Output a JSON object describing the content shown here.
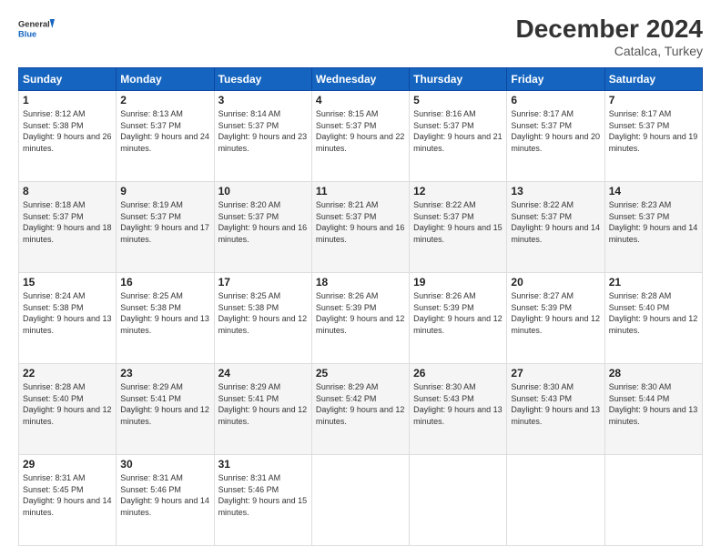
{
  "header": {
    "logo_general": "General",
    "logo_blue": "Blue",
    "month_year": "December 2024",
    "location": "Catalca, Turkey"
  },
  "days_of_week": [
    "Sunday",
    "Monday",
    "Tuesday",
    "Wednesday",
    "Thursday",
    "Friday",
    "Saturday"
  ],
  "weeks": [
    [
      {
        "day": 1,
        "sunrise": "8:12 AM",
        "sunset": "5:38 PM",
        "daylight": "9 hours and 26 minutes."
      },
      {
        "day": 2,
        "sunrise": "8:13 AM",
        "sunset": "5:37 PM",
        "daylight": "9 hours and 24 minutes."
      },
      {
        "day": 3,
        "sunrise": "8:14 AM",
        "sunset": "5:37 PM",
        "daylight": "9 hours and 23 minutes."
      },
      {
        "day": 4,
        "sunrise": "8:15 AM",
        "sunset": "5:37 PM",
        "daylight": "9 hours and 22 minutes."
      },
      {
        "day": 5,
        "sunrise": "8:16 AM",
        "sunset": "5:37 PM",
        "daylight": "9 hours and 21 minutes."
      },
      {
        "day": 6,
        "sunrise": "8:17 AM",
        "sunset": "5:37 PM",
        "daylight": "9 hours and 20 minutes."
      },
      {
        "day": 7,
        "sunrise": "8:17 AM",
        "sunset": "5:37 PM",
        "daylight": "9 hours and 19 minutes."
      }
    ],
    [
      {
        "day": 8,
        "sunrise": "8:18 AM",
        "sunset": "5:37 PM",
        "daylight": "9 hours and 18 minutes."
      },
      {
        "day": 9,
        "sunrise": "8:19 AM",
        "sunset": "5:37 PM",
        "daylight": "9 hours and 17 minutes."
      },
      {
        "day": 10,
        "sunrise": "8:20 AM",
        "sunset": "5:37 PM",
        "daylight": "9 hours and 16 minutes."
      },
      {
        "day": 11,
        "sunrise": "8:21 AM",
        "sunset": "5:37 PM",
        "daylight": "9 hours and 16 minutes."
      },
      {
        "day": 12,
        "sunrise": "8:22 AM",
        "sunset": "5:37 PM",
        "daylight": "9 hours and 15 minutes."
      },
      {
        "day": 13,
        "sunrise": "8:22 AM",
        "sunset": "5:37 PM",
        "daylight": "9 hours and 14 minutes."
      },
      {
        "day": 14,
        "sunrise": "8:23 AM",
        "sunset": "5:37 PM",
        "daylight": "9 hours and 14 minutes."
      }
    ],
    [
      {
        "day": 15,
        "sunrise": "8:24 AM",
        "sunset": "5:38 PM",
        "daylight": "9 hours and 13 minutes."
      },
      {
        "day": 16,
        "sunrise": "8:25 AM",
        "sunset": "5:38 PM",
        "daylight": "9 hours and 13 minutes."
      },
      {
        "day": 17,
        "sunrise": "8:25 AM",
        "sunset": "5:38 PM",
        "daylight": "9 hours and 12 minutes."
      },
      {
        "day": 18,
        "sunrise": "8:26 AM",
        "sunset": "5:39 PM",
        "daylight": "9 hours and 12 minutes."
      },
      {
        "day": 19,
        "sunrise": "8:26 AM",
        "sunset": "5:39 PM",
        "daylight": "9 hours and 12 minutes."
      },
      {
        "day": 20,
        "sunrise": "8:27 AM",
        "sunset": "5:39 PM",
        "daylight": "9 hours and 12 minutes."
      },
      {
        "day": 21,
        "sunrise": "8:28 AM",
        "sunset": "5:40 PM",
        "daylight": "9 hours and 12 minutes."
      }
    ],
    [
      {
        "day": 22,
        "sunrise": "8:28 AM",
        "sunset": "5:40 PM",
        "daylight": "9 hours and 12 minutes."
      },
      {
        "day": 23,
        "sunrise": "8:29 AM",
        "sunset": "5:41 PM",
        "daylight": "9 hours and 12 minutes."
      },
      {
        "day": 24,
        "sunrise": "8:29 AM",
        "sunset": "5:41 PM",
        "daylight": "9 hours and 12 minutes."
      },
      {
        "day": 25,
        "sunrise": "8:29 AM",
        "sunset": "5:42 PM",
        "daylight": "9 hours and 12 minutes."
      },
      {
        "day": 26,
        "sunrise": "8:30 AM",
        "sunset": "5:43 PM",
        "daylight": "9 hours and 13 minutes."
      },
      {
        "day": 27,
        "sunrise": "8:30 AM",
        "sunset": "5:43 PM",
        "daylight": "9 hours and 13 minutes."
      },
      {
        "day": 28,
        "sunrise": "8:30 AM",
        "sunset": "5:44 PM",
        "daylight": "9 hours and 13 minutes."
      }
    ],
    [
      {
        "day": 29,
        "sunrise": "8:31 AM",
        "sunset": "5:45 PM",
        "daylight": "9 hours and 14 minutes."
      },
      {
        "day": 30,
        "sunrise": "8:31 AM",
        "sunset": "5:46 PM",
        "daylight": "9 hours and 14 minutes."
      },
      {
        "day": 31,
        "sunrise": "8:31 AM",
        "sunset": "5:46 PM",
        "daylight": "9 hours and 15 minutes."
      },
      null,
      null,
      null,
      null
    ]
  ],
  "labels": {
    "sunrise": "Sunrise:",
    "sunset": "Sunset:",
    "daylight": "Daylight:"
  }
}
